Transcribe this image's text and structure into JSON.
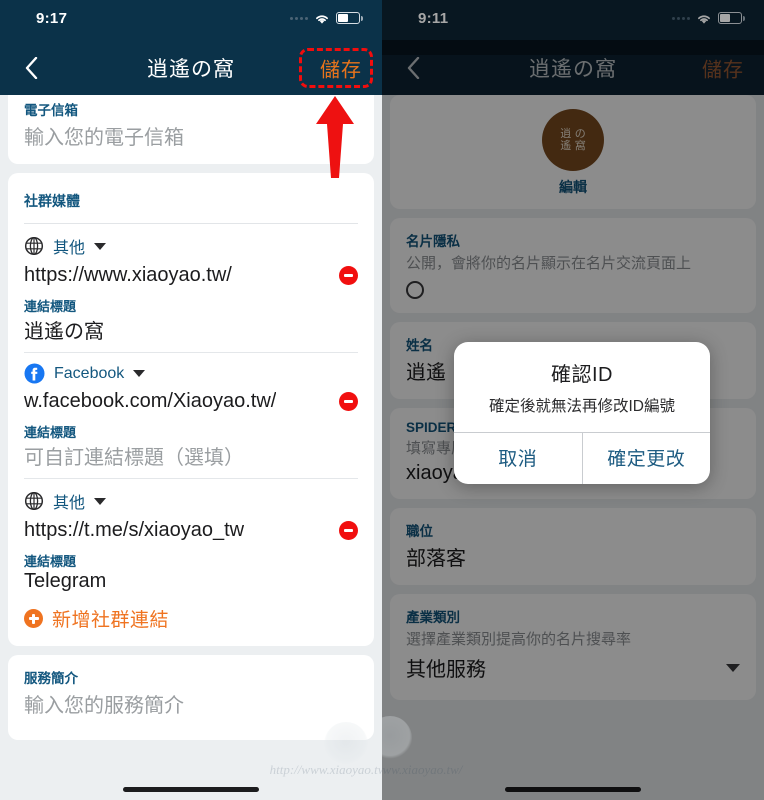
{
  "left": {
    "status": {
      "time": "9:17",
      "signal_icon": "signal-dots-icon",
      "wifi_icon": "wifi-icon",
      "battery_icon": "battery-icon"
    },
    "nav": {
      "back_icon": "chevron-left-icon",
      "title": "逍遙の窩",
      "save_label": "儲存"
    },
    "annotation": {
      "arrow_icon": "red-up-arrow-icon",
      "highlight_color": "#f20d0d"
    },
    "email_card": {
      "label": "電子信箱",
      "placeholder": "輸入您的電子信箱"
    },
    "social_card": {
      "section_title": "社群媒體",
      "link_title_label": "連結標題",
      "add_label": "新增社群連結",
      "add_icon": "plus-circle-icon",
      "items": [
        {
          "platform": "其他",
          "platform_icon": "globe-icon",
          "url": "https://www.xiaoyao.tw/",
          "title_label": "連結標題",
          "title_value": "逍遙の窩",
          "title_is_placeholder": false,
          "remove_icon": "minus-circle-icon"
        },
        {
          "platform": "Facebook",
          "platform_icon": "facebook-icon",
          "url": "w.facebook.com/Xiaoyao.tw/",
          "title_label": "連結標題",
          "title_value": "可自訂連結標題（選填）",
          "title_is_placeholder": true,
          "remove_icon": "minus-circle-icon"
        },
        {
          "platform": "其他",
          "platform_icon": "globe-icon",
          "url": "https://t.me/s/xiaoyao_tw",
          "title_label": "連結標題",
          "title_value": "Telegram",
          "title_is_placeholder": false,
          "remove_icon": "minus-circle-icon"
        }
      ]
    },
    "service_card": {
      "label": "服務簡介",
      "placeholder": "輸入您的服務簡介"
    }
  },
  "right": {
    "status": {
      "time": "9:11",
      "signal_icon": "signal-dots-icon",
      "wifi_icon": "wifi-icon",
      "battery_icon": "battery-icon"
    },
    "nav": {
      "back_icon": "chevron-left-icon",
      "title": "逍遙の窩",
      "save_label": "儲存"
    },
    "avatar_card": {
      "avatar_icon": "brand-avatar-icon",
      "avatar_line1": "逍 の",
      "avatar_line2": "遙 窩",
      "edit_label": "編輯"
    },
    "privacy_card": {
      "label": "名片隱私",
      "description": "公開，會將你的名片顯示在名片交流頁面上",
      "radio_icon": "radio-unchecked-icon"
    },
    "name_card": {
      "label": "姓名",
      "value": "逍遙"
    },
    "spidercard_card": {
      "label": "SPIDERCARD ID",
      "description": "填寫專屬ID完成個人化網址",
      "value": "xiaoyao"
    },
    "position_card": {
      "label": "職位",
      "value": "部落客"
    },
    "industry_card": {
      "label": "產業類別",
      "description": "選擇產業類別提高你的名片搜尋率",
      "value": "其他服務",
      "caret_icon": "chevron-down-icon"
    },
    "dialog": {
      "title": "確認ID",
      "message": "確定後就無法再修改ID編號",
      "cancel_label": "取消",
      "confirm_label": "確定更改"
    }
  },
  "watermark": {
    "url": "http://www.xiaoyao.tw/",
    "logo_icon": "watermark-logo-icon"
  },
  "colors": {
    "nav_bg": "#0b3249",
    "accent_orange": "#ef7320",
    "label_blue": "#13577f",
    "danger_red": "#f10f0f",
    "highlight_red": "#f20d0d"
  }
}
